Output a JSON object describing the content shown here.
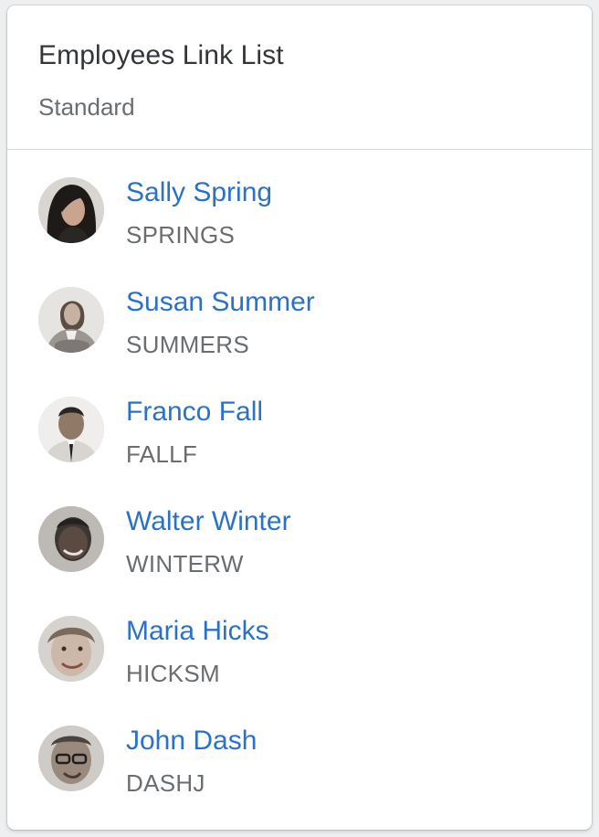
{
  "card": {
    "title": "Employees Link List",
    "subtitle": "Standard"
  },
  "employees": [
    {
      "name": "Sally Spring",
      "id": "SPRINGS",
      "avatar": "photo-woman-dark-hair"
    },
    {
      "name": "Susan Summer",
      "id": "SUMMERS",
      "avatar": "photo-woman-business"
    },
    {
      "name": "Franco Fall",
      "id": "FALLF",
      "avatar": "photo-man-suit"
    },
    {
      "name": "Walter Winter",
      "id": "WINTERW",
      "avatar": "photo-man-smiling"
    },
    {
      "name": "Maria Hicks",
      "id": "HICKSM",
      "avatar": "photo-woman-smiling"
    },
    {
      "name": "John Dash",
      "id": "DASHJ",
      "avatar": "photo-man-glasses"
    }
  ],
  "colors": {
    "link": "#2a72c8",
    "title": "#32363a",
    "secondary": "#6a6d70",
    "divider": "#d9d9d9"
  }
}
